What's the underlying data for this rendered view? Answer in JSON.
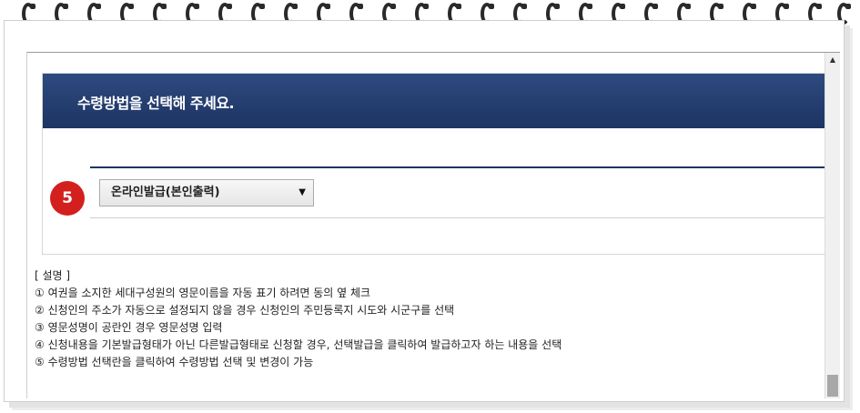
{
  "header": {
    "title": "수령방법을 선택해 주세요."
  },
  "step": {
    "number": "5"
  },
  "receipt_method": {
    "selected": "온라인발급(본인출력)"
  },
  "description": {
    "title": "[ 설명 ]",
    "items": [
      "① 여권을 소지한 세대구성원의 영문이름을 자동 표기 하려면 동의 옆 체크",
      "② 신청인의 주소가 자동으로 설정되지 않을 경우 신청인의 주민등록지 시도와 시군구를 선택",
      "③ 영문성명이 공란인 경우 영문성명 입력",
      "④ 신청내용을 기본발급형태가 아닌 다른발급형태로 신청할 경우, 선택발급을 클릭하여 발급하고자 하는 내용을 선택",
      "⑤ 수령방법 선택란을 클릭하여 수령방법 선택 및 변경이 가능"
    ]
  },
  "icons": {
    "dropdown": "triangle-down-icon",
    "scroll_up": "triangle-up-icon"
  },
  "colors": {
    "header_bg": "#1d3463",
    "step_badge": "#d41f1f"
  }
}
